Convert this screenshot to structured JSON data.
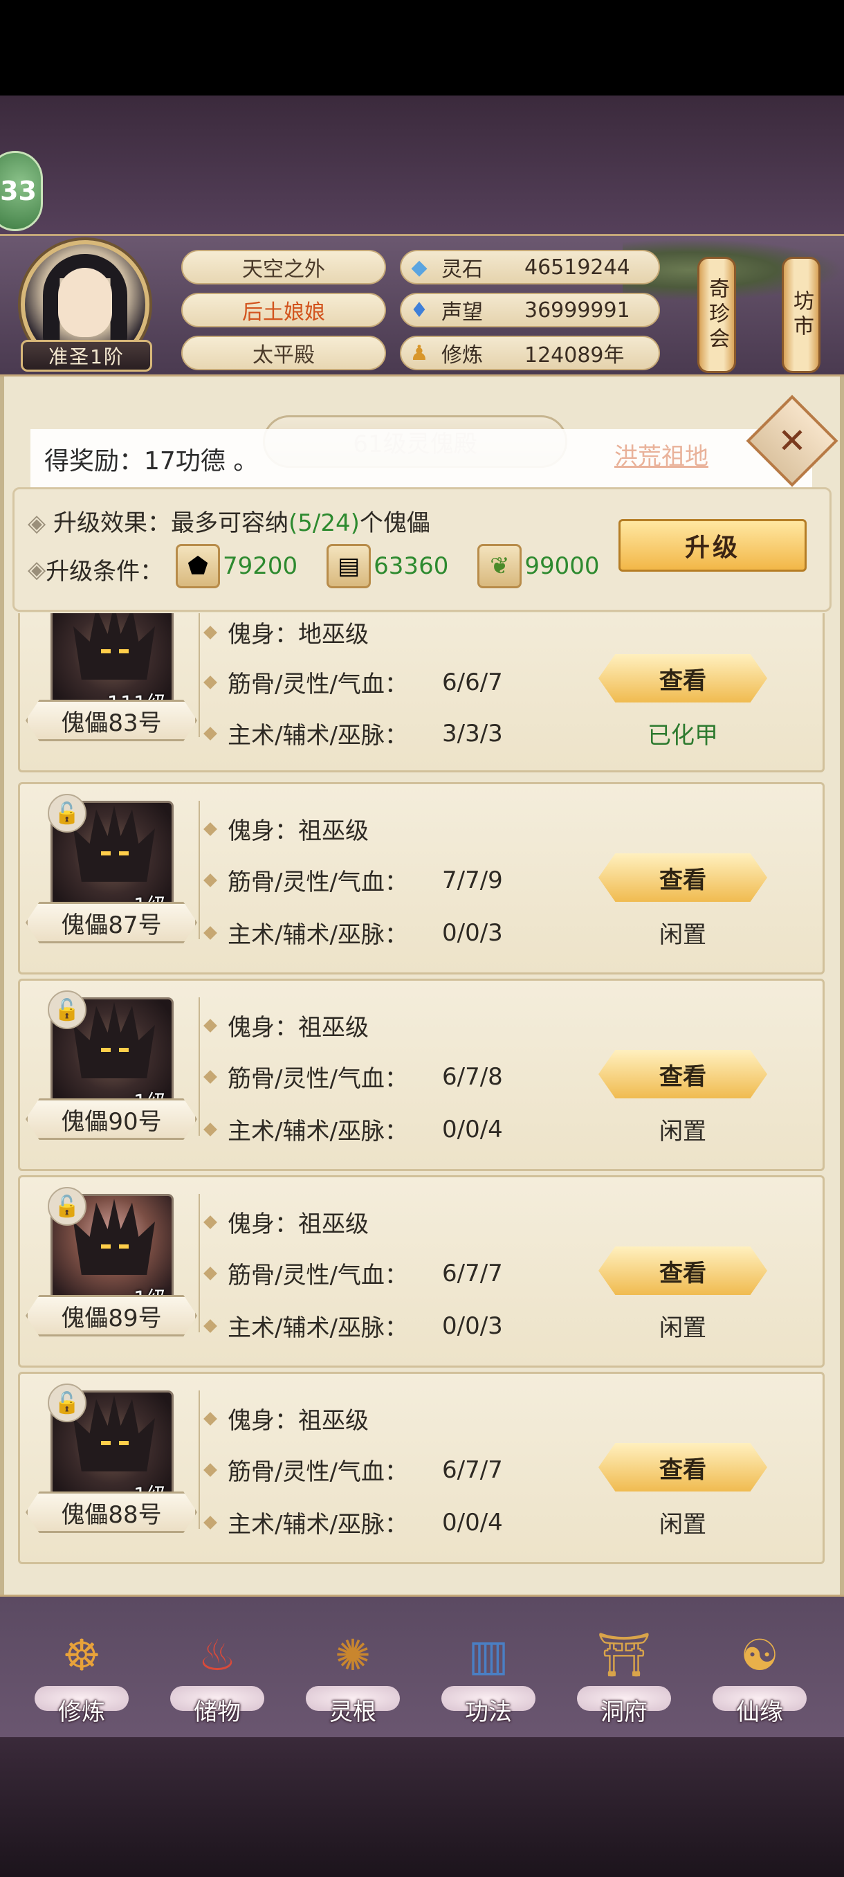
{
  "profile": {
    "level": "33",
    "rank": "准圣1阶",
    "realm": "天空之外",
    "title": "后土娘娘",
    "palace": "太平殿"
  },
  "resources": [
    {
      "icon": "spirit-stone-icon",
      "label": "灵石",
      "value": "46519244"
    },
    {
      "icon": "reputation-icon",
      "label": "声望",
      "value": "36999991"
    },
    {
      "icon": "meditation-icon",
      "label": "修炼",
      "value": "124089年"
    }
  ],
  "side_buttons": {
    "treasure": "奇珍会",
    "market": "坊市"
  },
  "reward": {
    "text": "得奖励：17功德 。"
  },
  "hall": {
    "title": "61级灵傀殿",
    "link": "洪荒祖地"
  },
  "upgrade": {
    "effect_label": "升级效果：",
    "effect_prefix": "最多可容纳",
    "effect_count": "(5/24)",
    "effect_suffix": "个傀儡",
    "cond_label": "升级条件：",
    "costs": [
      {
        "icon": "ore-icon",
        "value": "79200"
      },
      {
        "icon": "wood-icon",
        "value": "63360"
      },
      {
        "icon": "herb-icon",
        "value": "99000"
      }
    ],
    "button": "升级"
  },
  "labels": {
    "body": "傀身：",
    "stats": "筋骨/灵性/气血：",
    "skills": "主术/辅术/巫脉：",
    "view": "查看"
  },
  "puppets": [
    {
      "name": "傀儡83号",
      "level": "111级",
      "body": "地巫级",
      "stats": "6/6/7",
      "skills": "3/3/3",
      "status": "已化甲"
    },
    {
      "name": "傀儡87号",
      "level": "1级",
      "body": "祖巫级",
      "stats": "7/7/9",
      "skills": "0/0/3",
      "status": "闲置"
    },
    {
      "name": "傀儡90号",
      "level": "1级",
      "body": "祖巫级",
      "stats": "6/7/8",
      "skills": "0/0/4",
      "status": "闲置"
    },
    {
      "name": "傀儡89号",
      "level": "1级",
      "body": "祖巫级",
      "stats": "6/7/7",
      "skills": "0/0/3",
      "status": "闲置"
    },
    {
      "name": "傀儡88号",
      "level": "1级",
      "body": "祖巫级",
      "stats": "6/7/7",
      "skills": "0/0/4",
      "status": "闲置"
    }
  ],
  "nav": [
    {
      "label": "修炼",
      "icon": "cultivate-icon"
    },
    {
      "label": "储物",
      "icon": "storage-bag-icon"
    },
    {
      "label": "灵根",
      "icon": "spirit-root-icon"
    },
    {
      "label": "功法",
      "icon": "technique-book-icon"
    },
    {
      "label": "洞府",
      "icon": "cave-dwelling-icon"
    },
    {
      "label": "仙缘",
      "icon": "immortal-fate-icon"
    }
  ]
}
